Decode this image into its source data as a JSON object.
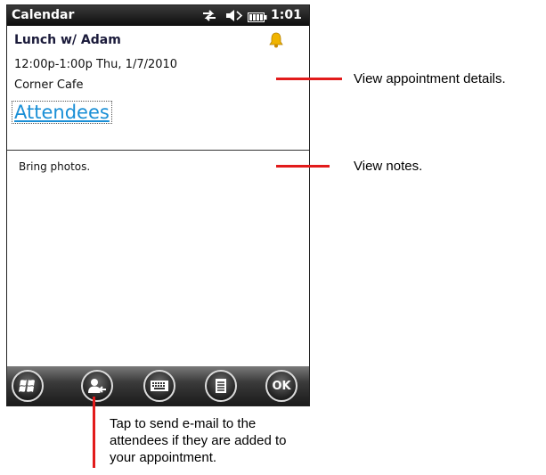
{
  "status_bar": {
    "app_title": "Calendar",
    "time": "1:01",
    "icons": [
      "connectivity-arrows-icon",
      "speaker-icon",
      "battery-icon"
    ]
  },
  "appointment": {
    "subject": "Lunch w/ Adam",
    "datetime": "12:00p-1:00p Thu, 1/7/2010",
    "location": "Corner Cafe",
    "attendees_link": "Attendees",
    "reminder_icon": "bell-icon"
  },
  "notes": {
    "text": "Bring photos."
  },
  "toolbar": {
    "buttons": [
      {
        "name": "start-button",
        "icon": "windows-logo-icon"
      },
      {
        "name": "send-email-attendees-button",
        "icon": "contact-send-icon"
      },
      {
        "name": "keyboard-button",
        "icon": "keyboard-icon"
      },
      {
        "name": "menu-button",
        "icon": "menu-list-icon"
      },
      {
        "name": "ok-button",
        "label": "OK"
      }
    ]
  },
  "callouts": {
    "details": "View appointment details.",
    "notes": "View notes.",
    "email_line1": "Tap to send e-mail to the",
    "email_line2": "attendees if they are added to",
    "email_line3": "your appointment."
  },
  "colors": {
    "accent_link": "#1a8fd6",
    "callout_line": "#e21b1b",
    "bell": "#f0b400"
  }
}
